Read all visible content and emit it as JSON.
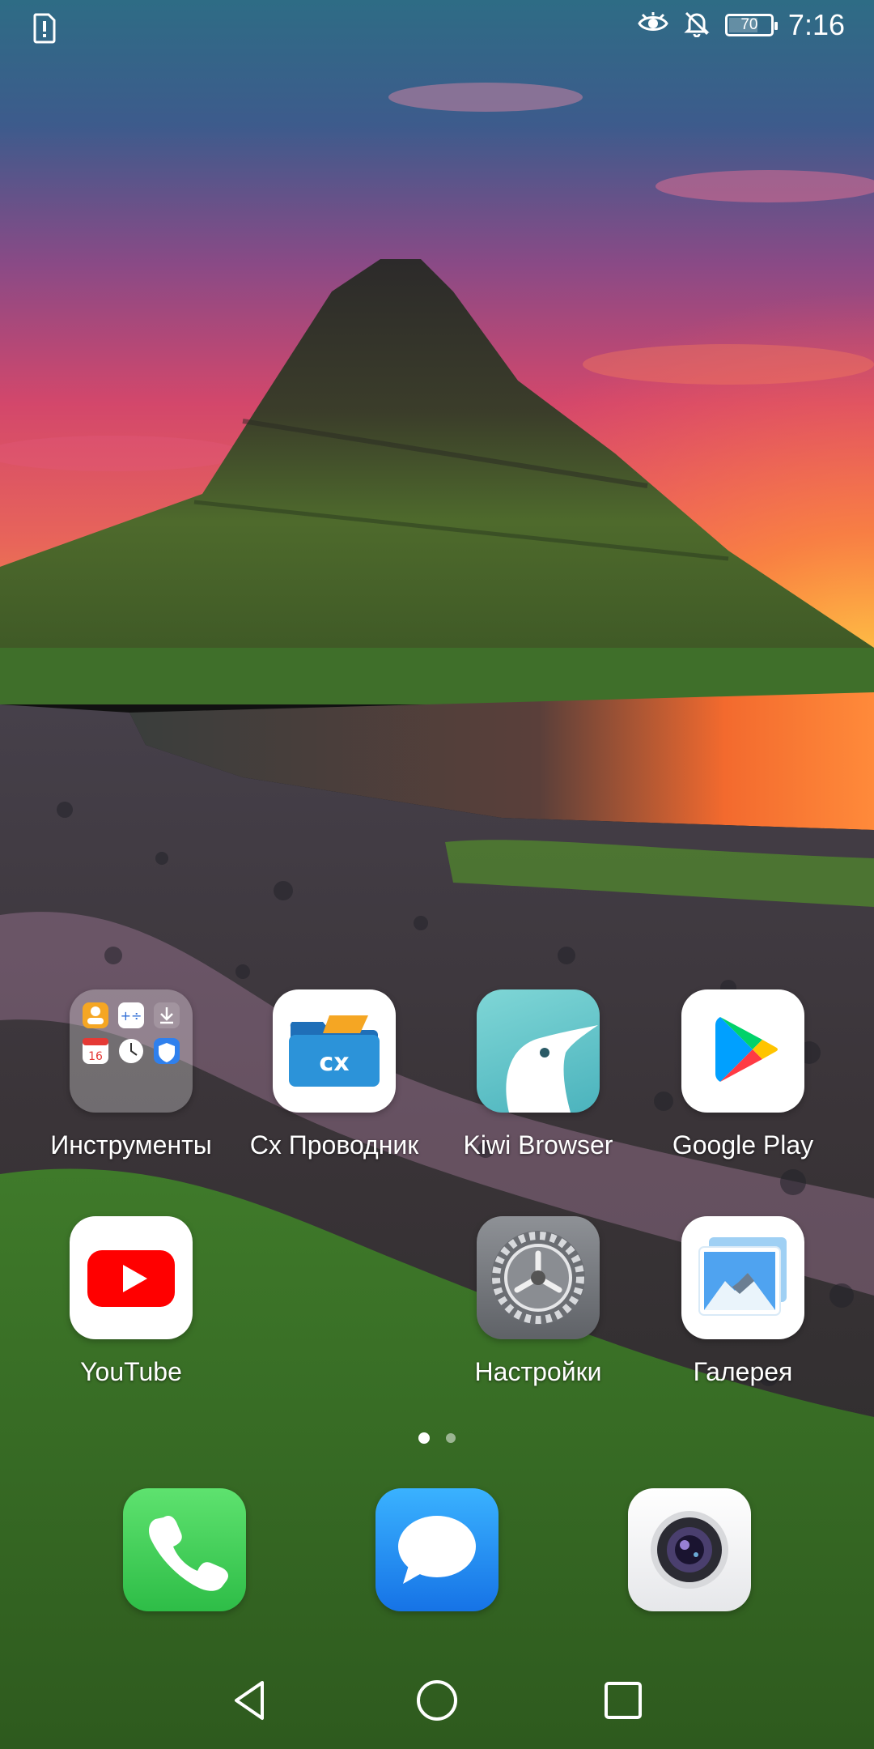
{
  "status_bar": {
    "time": "7:16",
    "battery_level": "70",
    "icons": [
      "alert-sim-icon",
      "eye-comfort-icon",
      "bell-muted-icon",
      "battery-icon"
    ]
  },
  "home": {
    "apps": [
      {
        "label": "Инструменты",
        "icon": "tools-folder-icon"
      },
      {
        "label": "Cx Проводник",
        "icon": "cx-file-explorer-icon",
        "badge_text": "cx"
      },
      {
        "label": "Kiwi Browser",
        "icon": "kiwi-browser-icon"
      },
      {
        "label": "Google Play",
        "icon": "google-play-icon"
      },
      {
        "label": "YouTube",
        "icon": "youtube-icon"
      },
      {
        "label": "Настройки",
        "icon": "settings-gear-icon"
      },
      {
        "label": "Галерея",
        "icon": "gallery-icon"
      }
    ],
    "folder_calendar_day": "16",
    "page_indicator": {
      "current": 1,
      "total": 2
    }
  },
  "dock": {
    "apps": [
      {
        "name": "Phone",
        "icon": "phone-icon"
      },
      {
        "name": "Messages",
        "icon": "messages-icon"
      },
      {
        "name": "Camera",
        "icon": "camera-icon"
      }
    ]
  },
  "navigation": {
    "buttons": [
      "back-icon",
      "home-icon",
      "recents-icon"
    ]
  },
  "colors": {
    "youtube_red": "#FF0000",
    "phone_green": "#34C759",
    "messages_blue": "#1E8FF5",
    "cx_blue": "#2C93D9",
    "kiwi_teal": "#5BC3C8"
  }
}
